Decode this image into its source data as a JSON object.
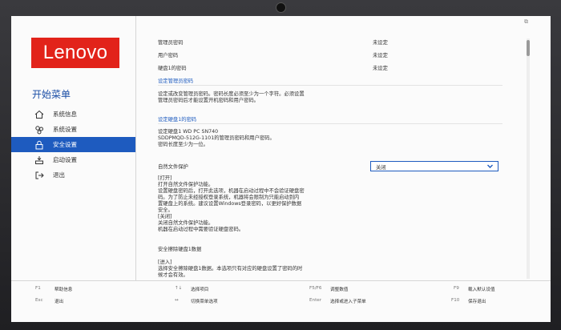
{
  "brand": {
    "logo_text": "Lenovo"
  },
  "menu": {
    "title": "开始菜单",
    "items": [
      {
        "label": "系统信息",
        "icon": "home-icon"
      },
      {
        "label": "系统设置",
        "icon": "gear-icon"
      },
      {
        "label": "安全设置",
        "icon": "lock-icon",
        "active": true
      },
      {
        "label": "启动设置",
        "icon": "boot-icon"
      },
      {
        "label": "退出",
        "icon": "exit-icon"
      }
    ]
  },
  "content": {
    "password_rows": [
      {
        "label": "管理员密码",
        "value": "未设定"
      },
      {
        "label": "用户密码",
        "value": "未设定"
      },
      {
        "label": "硬盘1的密码",
        "value": "未设定"
      }
    ],
    "set_admin_link": "设定管理员密码",
    "set_admin_desc_1": "设定或改变管理员密码。密码长度必须至少为一个字符。必须设置",
    "set_admin_desc_2": "管理员密码后才能设置开机密码和用户密码。",
    "set_disk_link": "设定硬盘1的密码",
    "set_disk_desc_1": "设定硬盘1 WD PC SN740",
    "set_disk_desc_2": "SDDPMQD-512G-1101的管理员密码和用户密码。",
    "set_disk_desc_3": "密码长度至少为一位。",
    "auto_protect_label": "自然文件保护",
    "auto_protect_value": "关闭",
    "open_tag": "[打开]",
    "open_desc": [
      "打开自然文件保护功能。",
      "设置硬盘密码后，打开此选项，机器在启动过程中不会验证硬盘密",
      "码。为了防止未经授权登录系统，机器将会限制为只能启动到内",
      "置硬盘上的系统。建议设置Windows登录密码，以更好保护数据",
      "安全。"
    ],
    "close_tag": "[关闭]",
    "close_desc": [
      "关闭自然文件保护功能。",
      "机器在启动过程中需要验证硬盘密码。"
    ],
    "erase_label": "安全擦除硬盘1数据",
    "enter_tag": "[进入]",
    "enter_desc": [
      "选择安全擦除硬盘1数据。本选项只有对应的硬盘设置了密码的时",
      "候才会有效。"
    ]
  },
  "footer": {
    "keys": [
      {
        "key": "F1",
        "label": "帮助信息"
      },
      {
        "key": "Esc",
        "label": "退出"
      },
      {
        "key": "↑↓",
        "label": "选择项目"
      },
      {
        "key": "↔",
        "label": "切换菜单选项"
      },
      {
        "key": "F5/F6",
        "label": "调整数值"
      },
      {
        "key": "Enter",
        "label": "选择或进入子菜单"
      },
      {
        "key": "F9",
        "label": "载入默认设值"
      },
      {
        "key": "F10",
        "label": "保存退出"
      }
    ]
  },
  "colors": {
    "brand_red": "#e2231a",
    "accent_blue": "#1e5bbf"
  }
}
